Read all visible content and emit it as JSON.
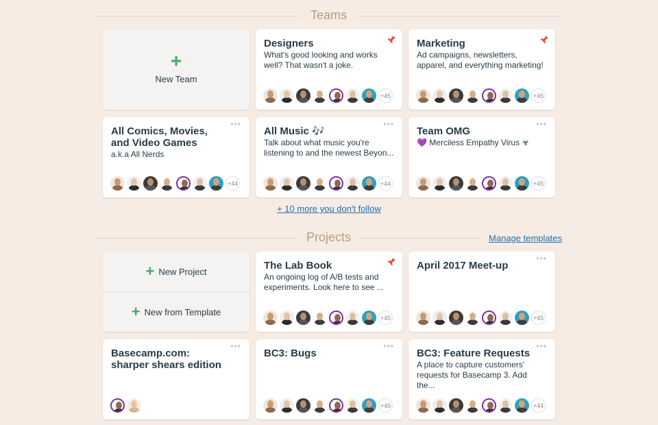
{
  "teams_section": {
    "title": "Teams"
  },
  "new_team": {
    "label": "New Team",
    "icon": "plus-icon"
  },
  "teams": [
    {
      "name": "Designers",
      "desc": "What's good looking and works well? That wasn't a joke.",
      "pinned": true,
      "more": "+45"
    },
    {
      "name": "Marketing",
      "desc": "Ad campaigns, newsletters, apparel, and everything marketing!",
      "pinned": true,
      "more": "+45"
    },
    {
      "name": "All Comics, Movies, and Video Games",
      "desc": "a.k.a All Nerds",
      "pinned": false,
      "more": "+44"
    },
    {
      "name": "All Music 🎶",
      "desc": "Talk about what music you're listening to and the newest Beyon...",
      "pinned": false,
      "more": "+44"
    },
    {
      "name": "Team OMG",
      "desc": "💜 Merciless Empathy Virus ☣",
      "pinned": false,
      "more": "+45"
    }
  ],
  "follow_link": "+ 10 more you don't follow",
  "projects_section": {
    "title": "Projects",
    "manage_link": "Manage templates"
  },
  "new_project": {
    "label": "New Project"
  },
  "new_from_template": {
    "label": "New from Template"
  },
  "projects": [
    {
      "name": "The Lab Book",
      "desc": "An ongoing log of A/B tests and experiments. Look here to see ...",
      "pinned": true,
      "more": "+45"
    },
    {
      "name": "April 2017 Meet-up",
      "desc": "",
      "pinned": false,
      "more": "+45"
    },
    {
      "name": "Basecamp.com: sharper shears edition",
      "desc": "",
      "pinned": false,
      "more": ""
    },
    {
      "name": "BC3: Bugs",
      "desc": "",
      "pinned": false,
      "more": "+45"
    },
    {
      "name": "BC3: Feature Requests",
      "desc": "A place to capture customers' requests for Basecamp 3. Add the...",
      "pinned": false,
      "more": "+44"
    }
  ],
  "colors": {
    "accent_green": "#47a86c",
    "link_blue": "#1f6fb5",
    "pin_red": "#e0533a",
    "section_title": "#b89b7e"
  }
}
